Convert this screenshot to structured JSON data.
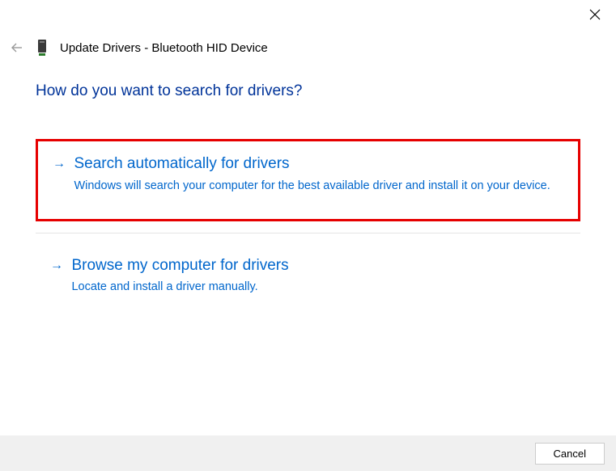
{
  "header": {
    "title": "Update Drivers - Bluetooth HID Device"
  },
  "main": {
    "heading": "How do you want to search for drivers?"
  },
  "options": {
    "auto": {
      "title": "Search automatically for drivers",
      "desc": "Windows will search your computer for the best available driver and install it on your device."
    },
    "browse": {
      "title": "Browse my computer for drivers",
      "desc": "Locate and install a driver manually."
    }
  },
  "footer": {
    "cancel": "Cancel"
  }
}
